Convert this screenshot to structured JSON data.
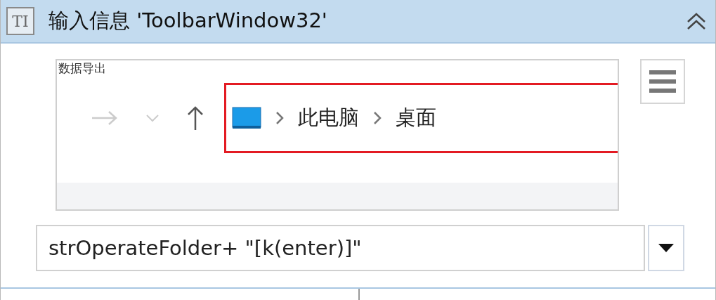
{
  "header": {
    "icon_text": "TI",
    "title": "输入信息 'ToolbarWindow32'",
    "expanded": true
  },
  "preview": {
    "window_caption": "数据导出",
    "breadcrumb": [
      "此电脑",
      "桌面"
    ],
    "highlighted": true
  },
  "input": {
    "value": "strOperateFolder+ \"[k(enter)]\""
  }
}
